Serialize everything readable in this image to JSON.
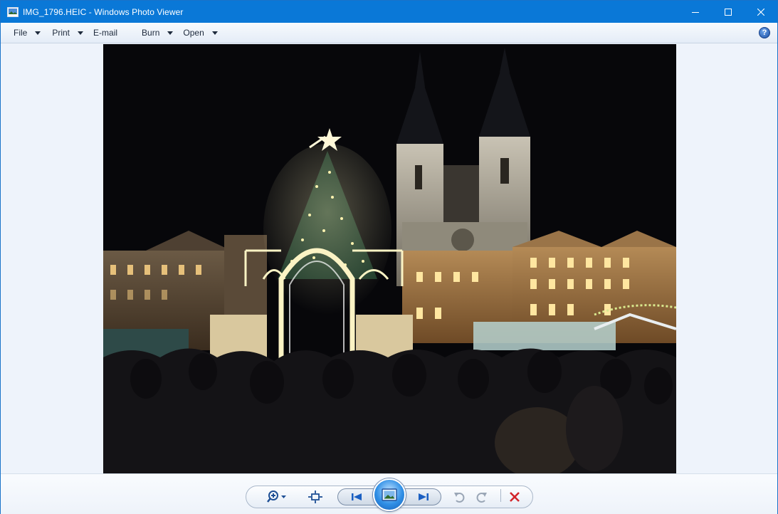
{
  "window": {
    "title": "IMG_1796.HEIC - Windows Photo Viewer",
    "icon": "photo-viewer-icon",
    "controls": [
      "minimize-icon",
      "maximize-icon",
      "close-icon"
    ]
  },
  "menubar": {
    "items": [
      {
        "label": "File",
        "has_dropdown": true
      },
      {
        "label": "Print",
        "has_dropdown": true
      },
      {
        "label": "E-mail",
        "has_dropdown": false
      },
      {
        "label": "Burn",
        "has_dropdown": true
      },
      {
        "label": "Open",
        "has_dropdown": true
      }
    ],
    "help_label": "?"
  },
  "photo": {
    "icon": "photo-image"
  },
  "toolbar": {
    "buttons": [
      "zoom-icon",
      "actual-size-icon",
      "previous-icon",
      "slideshow-icon",
      "next-icon",
      "rotate-counterclockwise-icon",
      "rotate-clockwise-icon",
      "delete-icon"
    ]
  },
  "colors": {
    "titlebar": "#0a78d7",
    "background": "#eef3fb",
    "delete": "#d2252b",
    "nav_arrow": "#1a5fc2"
  }
}
